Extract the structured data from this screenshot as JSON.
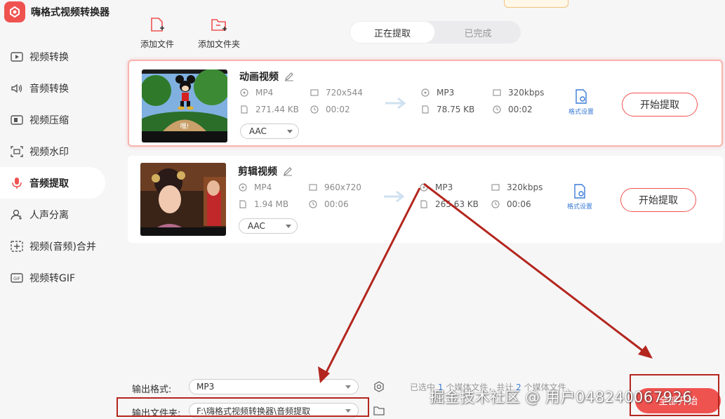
{
  "app": {
    "title": "嗨格式视频转换器"
  },
  "sidebar": {
    "items": [
      {
        "label": "视频转换",
        "icon": "video-convert-icon"
      },
      {
        "label": "音频转换",
        "icon": "audio-convert-icon"
      },
      {
        "label": "视频压缩",
        "icon": "video-compress-icon"
      },
      {
        "label": "视频水印",
        "icon": "watermark-icon"
      },
      {
        "label": "音频提取",
        "icon": "microphone-icon",
        "active": true
      },
      {
        "label": "人声分离",
        "icon": "person-icon"
      },
      {
        "label": "视频(音频)合并",
        "icon": "merge-icon"
      },
      {
        "label": "视频转GIF",
        "icon": "gif-icon"
      }
    ]
  },
  "toolbar": {
    "add_file": "添加文件",
    "add_folder": "添加文件夹"
  },
  "tabs": {
    "extracting": "正在提取",
    "done": "已完成"
  },
  "files": [
    {
      "name": "动画视频",
      "src_format": "MP4",
      "src_resolution": "720x544",
      "src_size": "271.44 KB",
      "src_duration": "00:02",
      "codec": "AAC",
      "out_format": "MP3",
      "out_bitrate": "320kbps",
      "out_size": "78.75 KB",
      "out_duration": "00:02",
      "format_settings": "格式设置",
      "start_label": "开始提取",
      "thumb_caption": "嘿!"
    },
    {
      "name": "剪辑视频",
      "src_format": "MP4",
      "src_resolution": "960x720",
      "src_size": "1.94 MB",
      "src_duration": "00:06",
      "codec": "AAC",
      "out_format": "MP3",
      "out_bitrate": "320kbps",
      "out_size": "265.63 KB",
      "out_duration": "00:06",
      "format_settings": "格式设置",
      "start_label": "开始提取"
    }
  ],
  "bottom": {
    "output_format_label": "输出格式:",
    "output_format_value": "MP3",
    "output_folder_label": "输出文件夹:",
    "output_folder_value": "F:\\嗨格式视频转换器\\音频提取",
    "status_prefix": "已选中",
    "status_selected": "1",
    "status_mid": "个媒体文件，共计",
    "status_total": "2",
    "status_suffix": "个媒体文件",
    "start_all": "全部开始"
  },
  "watermark": "掘金技术社区 @ 用户0482400679​26",
  "colors": {
    "accent": "#ef5350",
    "link": "#3a7bd5",
    "annotation": "#b3261e"
  }
}
